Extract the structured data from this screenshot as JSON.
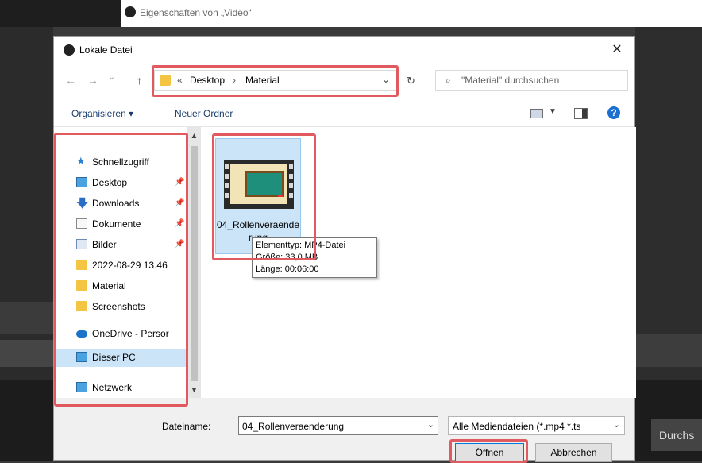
{
  "background": {
    "properties_title": "Eigenschaften von „Video“",
    "right_button_label": "Durchs"
  },
  "dialog": {
    "title": "Lokale Datei",
    "close_glyph": "✕",
    "nav": {
      "back_glyph": "←",
      "forward_glyph": "→",
      "recent_glyph": "⌄",
      "up_glyph": "↑",
      "refresh_glyph": "↻"
    },
    "address": {
      "overflow": "«",
      "parts": [
        "Desktop",
        "Material"
      ],
      "separator": "›",
      "dropdown_glyph": "⌄"
    },
    "search": {
      "placeholder": "\"Material\" durchsuchen",
      "icon_glyph": "⌕"
    },
    "toolbar": {
      "organize_label": "Organisieren ▾",
      "new_folder_label": "Neuer Ordner",
      "view_dropdown_glyph": "▼",
      "help_glyph": "?"
    },
    "sidebar": {
      "items": [
        {
          "label": "Schnellzugriff",
          "icon": "star-icon",
          "glyph": "★"
        },
        {
          "label": "Desktop",
          "icon": "desktop-icon",
          "pinned": "📌"
        },
        {
          "label": "Downloads",
          "icon": "download-icon",
          "glyph": "🡇",
          "pinned": "📌"
        },
        {
          "label": "Dokumente",
          "icon": "document-icon",
          "pinned": "📌"
        },
        {
          "label": "Bilder",
          "icon": "pictures-icon",
          "pinned": "📌"
        },
        {
          "label": "2022-08-29 13.46",
          "icon": "folder-icon"
        },
        {
          "label": "Material",
          "icon": "folder-icon"
        },
        {
          "label": "Screenshots",
          "icon": "folder-icon"
        },
        {
          "label": "OneDrive - Persor",
          "icon": "onedrive-icon"
        },
        {
          "label": "Dieser PC",
          "icon": "pc-icon"
        },
        {
          "label": "Netzwerk",
          "icon": "network-icon"
        }
      ],
      "scroll_up_glyph": "▲",
      "scroll_down_glyph": "▼"
    },
    "files": [
      {
        "name": "04_Rollenveraenderung",
        "type_icon": "video-file-icon",
        "selected": true
      }
    ],
    "tooltip": {
      "type": "Elementtyp: MP4-Datei",
      "size": "Größe: 33,0 MB",
      "length": "Länge: 00:06:00"
    },
    "filename_label": "Dateiname:",
    "filename_value": "04_Rollenveraenderung",
    "filter_value": "Alle Mediendateien (*.mp4 *.ts",
    "dropdown_glyph": "⌄",
    "open_label": "Öffnen",
    "cancel_label": "Abbrechen"
  },
  "colors": {
    "highlight": "#e05a5f",
    "selection": "#cce4f7",
    "link": "#1a3d6e"
  }
}
